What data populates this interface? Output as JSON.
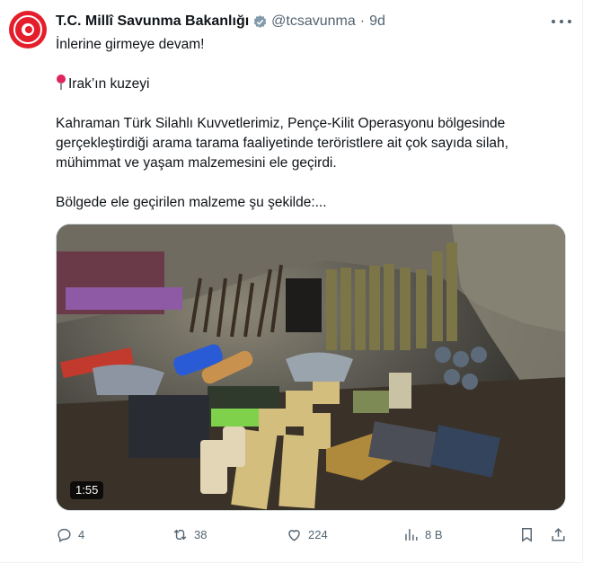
{
  "author": {
    "name": "T.C. Millî Savunma Bakanlığı",
    "handle": "@tcsavunma",
    "separator": "·",
    "time": "9d"
  },
  "tweet": {
    "line1": "İnlerine girmeye devam!",
    "location": "Irak’ın kuzeyi",
    "paragraph_lines": [
      "Kahraman Türk Silahlı Kuvvetlerimiz, Pençe-Kilit Operasyonu bölgesinde",
      "gerçekleştirdiği arama tarama faaliyetinde teröristlere ait çok sayıda silah,",
      "mühimmat ve yaşam malzemesini ele geçirdi."
    ],
    "closing": "Bölgede ele geçirilen malzeme şu şekilde:..."
  },
  "media": {
    "duration": "1:55",
    "icon": "video-thumbnail"
  },
  "actions": {
    "replies": "4",
    "reposts": "38",
    "likes": "224",
    "views": "8 B"
  },
  "colors": {
    "verified": "#829aab",
    "muted": "#536471",
    "avatar_red": "#e41e2b"
  }
}
